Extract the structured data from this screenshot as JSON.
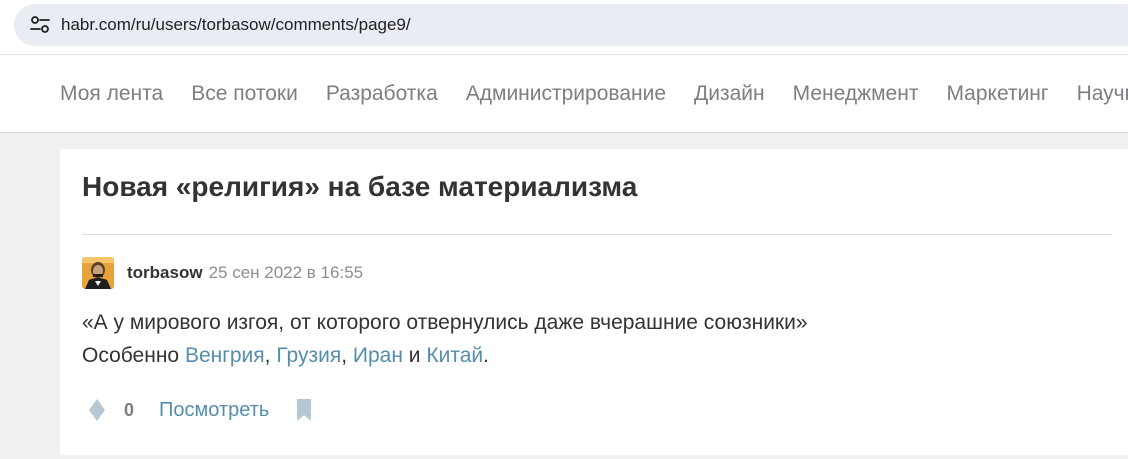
{
  "browser": {
    "url": "habr.com/ru/users/torbasow/comments/page9/",
    "site_info_icon": "tune-icon"
  },
  "nav": {
    "items": [
      {
        "label": "Моя лента"
      },
      {
        "label": "Все потоки"
      },
      {
        "label": "Разработка"
      },
      {
        "label": "Администрирование"
      },
      {
        "label": "Дизайн"
      },
      {
        "label": "Менеджмент"
      },
      {
        "label": "Маркетинг"
      },
      {
        "label": "Научпоп"
      }
    ]
  },
  "post": {
    "title": "Новая «религия» на базе материализма"
  },
  "comment": {
    "username": "torbasow",
    "timestamp": "25 сен 2022 в 16:55",
    "quote": "«А у мирового изгоя, от которого отвернулись даже вчерашние союзники»",
    "line2_prefix": "Особенно ",
    "links": [
      "Венгрия",
      "Грузия",
      "Иран",
      "Китай"
    ],
    "sep1": ", ",
    "sep2": ", ",
    "sep3": " и ",
    "line2_suffix": "."
  },
  "footer": {
    "vote_count": "0",
    "view_label": "Посмотреть",
    "vote_icon": "diamond-vote-icon",
    "bookmark_icon": "bookmark-icon"
  },
  "colors": {
    "link": "#548eaa",
    "nav_text": "#7b7e82",
    "title": "#333333",
    "page_bg": "#f0f0f0"
  }
}
